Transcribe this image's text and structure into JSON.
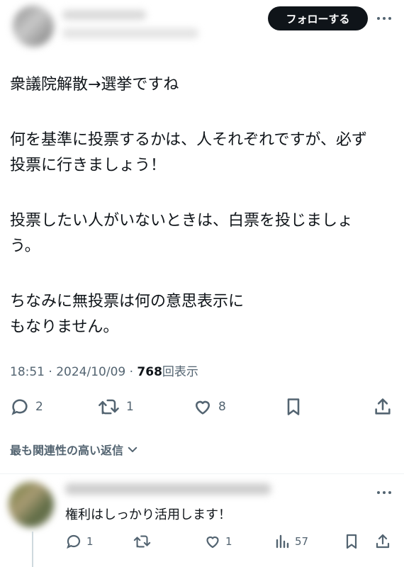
{
  "tweet": {
    "follow_label": "フォローする",
    "lines": [
      "衆議院解散→選挙ですね",
      "何を基準に投票するかは、人それぞれですが、必ず",
      "投票に行きましょう！",
      "投票したい人がいないときは、白票を投じましょ",
      "う。",
      "ちなみに無投票は何の意思表示に",
      "もなりません。"
    ],
    "time": "18:51",
    "date": "2024/10/09",
    "views": "768",
    "views_suffix": "回表示",
    "separator": "·",
    "reply_count": "2",
    "retweet_count": "1",
    "like_count": "8"
  },
  "relevant_label": "最も関連性の高い返信",
  "reply": {
    "text": "権利はしっかり活用します！",
    "reply_count": "1",
    "like_count": "1",
    "view_count": "57"
  },
  "icons": [
    "more-icon",
    "reply-icon",
    "retweet-icon",
    "like-icon",
    "bookmark-icon",
    "share-icon",
    "views-icon",
    "chevron-down-icon"
  ]
}
